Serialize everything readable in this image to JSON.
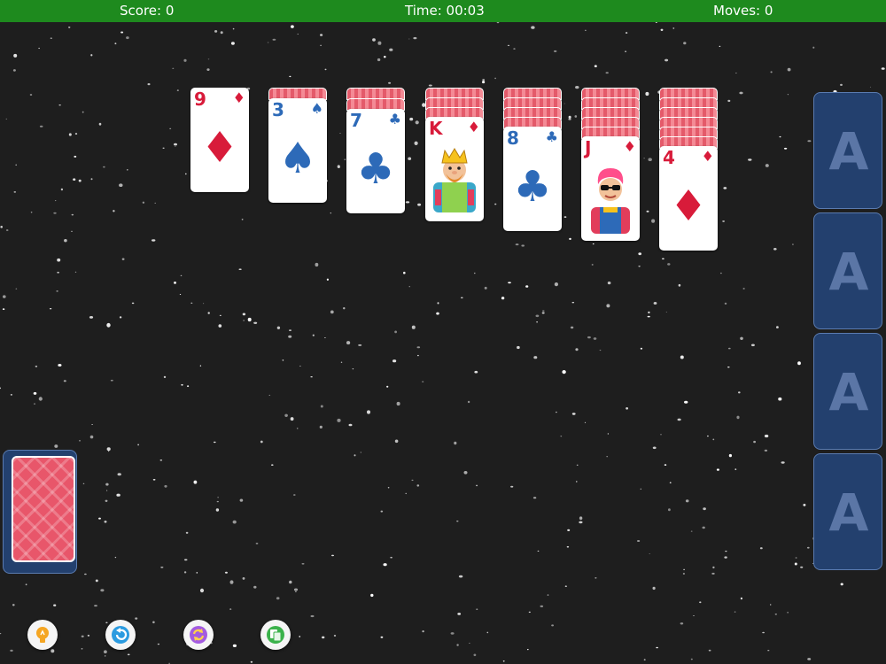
{
  "status": {
    "score": "Score: 0",
    "time": "Time: 00:03",
    "moves": "Moves: 0"
  },
  "colors": {
    "status_bar": "#1e8a1e",
    "table": "#1e1e1e",
    "foundation": "#23406e",
    "red_suit": "#d81b3a",
    "black_suit": "#2d6ab8",
    "card_back": "#e8566a"
  },
  "tableau": [
    {
      "hidden": 0,
      "rank": "9",
      "suit": "diamond",
      "suit_glyph": "♦"
    },
    {
      "hidden": 1,
      "rank": "3",
      "suit": "spade",
      "suit_glyph": "♠"
    },
    {
      "hidden": 2,
      "rank": "7",
      "suit": "club",
      "suit_glyph": "♣"
    },
    {
      "hidden": 3,
      "rank": "K",
      "suit": "diamond",
      "suit_glyph": "♦"
    },
    {
      "hidden": 4,
      "rank": "8",
      "suit": "club",
      "suit_glyph": "♣"
    },
    {
      "hidden": 5,
      "rank": "J",
      "suit": "diamond",
      "suit_glyph": "♦"
    },
    {
      "hidden": 6,
      "rank": "4",
      "suit": "diamond",
      "suit_glyph": "♦"
    }
  ],
  "foundations": [
    "A",
    "A",
    "A",
    "A"
  ],
  "stock": {
    "icon": "card-back"
  },
  "toolbar": [
    {
      "name": "hint-button",
      "icon": "lightbulb-icon"
    },
    {
      "name": "undo-button",
      "icon": "undo-icon"
    },
    {
      "name": "new-game-button",
      "icon": "refresh-icon"
    },
    {
      "name": "settings-button",
      "icon": "cards-icon"
    }
  ]
}
